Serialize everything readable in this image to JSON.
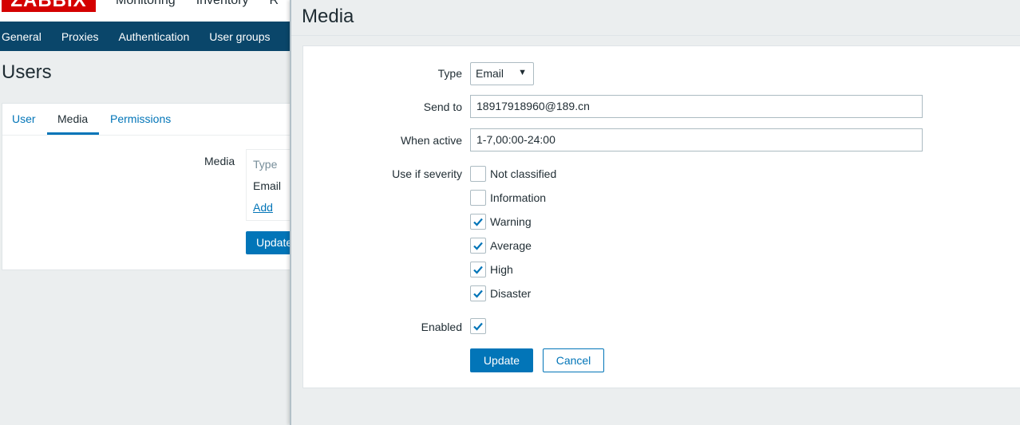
{
  "header": {
    "logo_text": "ZABBIX",
    "main_menu": [
      "Monitoring",
      "Inventory",
      "R"
    ]
  },
  "subnav": [
    "General",
    "Proxies",
    "Authentication",
    "User groups"
  ],
  "page": {
    "title": "Users",
    "tabs": [
      {
        "label": "User",
        "active": false
      },
      {
        "label": "Media",
        "active": true
      },
      {
        "label": "Permissions",
        "active": false
      }
    ],
    "media_label": "Media",
    "media_table": {
      "header": "Type",
      "rows": [
        "Email"
      ],
      "add_link": "Add"
    },
    "update_button": "Update"
  },
  "dialog": {
    "title": "Media",
    "type": {
      "label": "Type",
      "value": "Email",
      "arrow": "▼"
    },
    "send_to": {
      "label": "Send to",
      "value": "18917918960@189.cn"
    },
    "when_active": {
      "label": "When active",
      "value": "1-7,00:00-24:00"
    },
    "severity": {
      "label": "Use if severity",
      "options": [
        {
          "label": "Not classified",
          "checked": false
        },
        {
          "label": "Information",
          "checked": false
        },
        {
          "label": "Warning",
          "checked": true
        },
        {
          "label": "Average",
          "checked": true
        },
        {
          "label": "High",
          "checked": true
        },
        {
          "label": "Disaster",
          "checked": true
        }
      ]
    },
    "enabled": {
      "label": "Enabled",
      "checked": true
    },
    "update_button": "Update",
    "cancel_button": "Cancel"
  },
  "colors": {
    "accent": "#0275b8",
    "nav_bg": "#0a466a",
    "logo_bg": "#d40000"
  }
}
